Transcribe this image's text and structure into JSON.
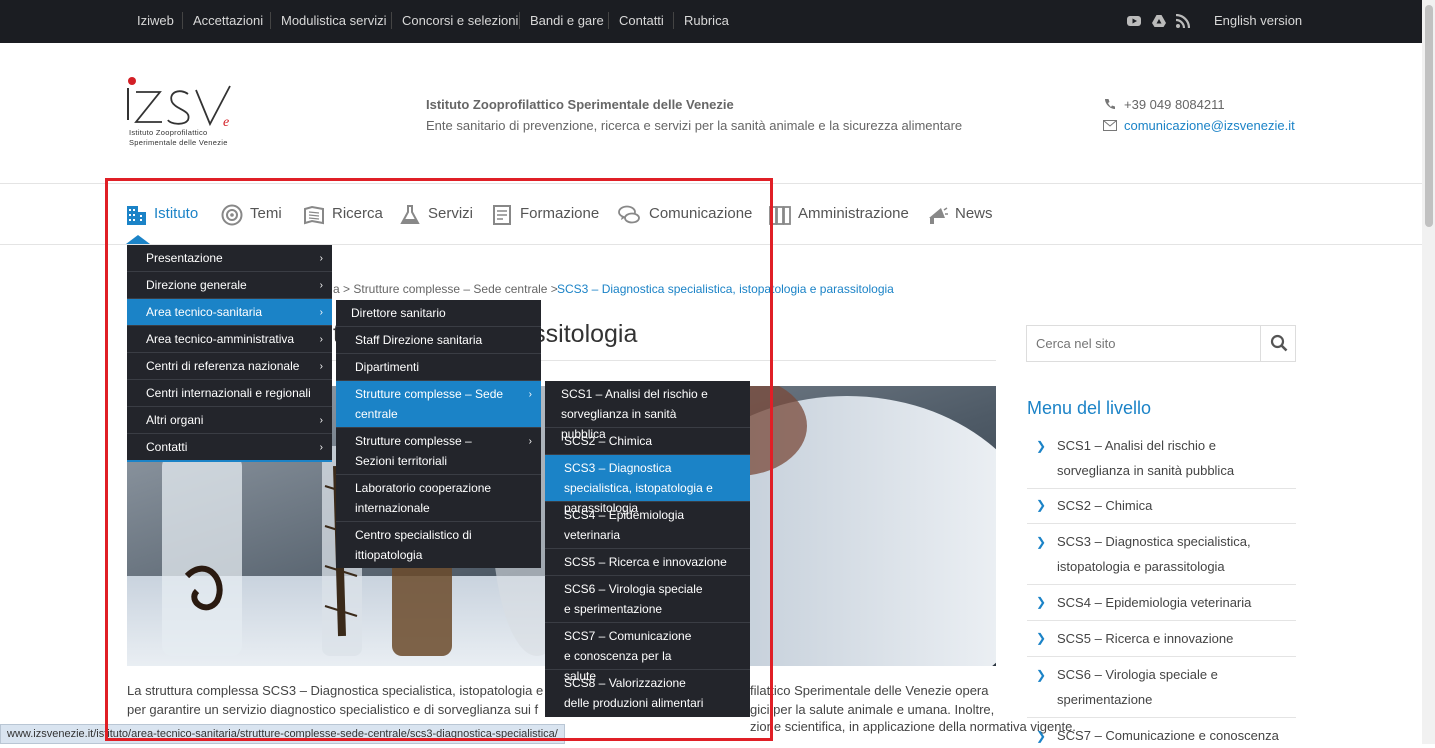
{
  "topbar": {
    "links": [
      "Iziweb",
      "Accettazioni",
      "Modulistica servizi",
      "Concorsi e selezioni",
      "Bandi e gare",
      "Contatti",
      "Rubrica"
    ],
    "social_icons": [
      "youtube-icon",
      "drive-icon",
      "rss-icon"
    ],
    "lang": "English version"
  },
  "header": {
    "logo_mark": "IZSVe",
    "logo_lines": [
      "Istituto Zooprofilattico",
      "Sperimentale delle Venezie"
    ],
    "org_name": "Istituto Zooprofilattico Sperimentale delle Venezie",
    "org_desc": "Ente sanitario di prevenzione, ricerca e servizi per la sanità animale e la sicurezza alimentare",
    "phone": "+39 049 8084211",
    "email": "comunicazione@izsvenezie.it"
  },
  "nav": {
    "items": [
      {
        "label": "Istituto",
        "icon": "building-icon"
      },
      {
        "label": "Temi",
        "icon": "target-icon"
      },
      {
        "label": "Ricerca",
        "icon": "book-icon"
      },
      {
        "label": "Servizi",
        "icon": "flask-icon"
      },
      {
        "label": "Formazione",
        "icon": "document-icon"
      },
      {
        "label": "Comunicazione",
        "icon": "chat-icon"
      },
      {
        "label": "Amministrazione",
        "icon": "folders-icon"
      },
      {
        "label": "News",
        "icon": "megaphone-icon"
      }
    ]
  },
  "menu1": [
    "Presentazione",
    "Direzione generale",
    "Area tecnico-sanitaria",
    "Area tecnico-amministrativa",
    "Centri di referenza nazionale",
    "Centri internazionali e regionali",
    "Altri organi",
    "Contatti"
  ],
  "menu2": [
    "Direttore sanitario",
    "Staff Direzione sanitaria",
    "Dipartimenti",
    "Strutture complesse – Sede centrale",
    "Strutture complesse – Sezioni territoriali",
    "Laboratorio cooperazione internazionale",
    "Centro specialistico di ittiopatologia"
  ],
  "menu3": [
    "SCS1 – Analisi del rischio e sorveglianza in sanità pubblica",
    "SCS2 – Chimica",
    "SCS3 – Diagnostica specialistica, istopatologia e parassitologia",
    "SCS4 – Epidemiologia veterinaria",
    "SCS5 – Ricerca e innovazione",
    "SCS6 – Virologia speciale e sperimentazione",
    "SCS7 – Comunicazione e conoscenza per la salute",
    "SCS8 – Valorizzazione delle produzioni alimentari"
  ],
  "breadcrumb": {
    "visible_part": "a > Strutture complesse – Sede centrale > ",
    "current": "SCS3 – Diagnostica specialistica, istopatologia e parassitologia"
  },
  "page": {
    "title_visible": "topatologia e parassitologia",
    "para_line1_left": "La struttura complessa SCS3 – Diagnostica specialistica, istopatologia e",
    "para_line1_right": "filattico Sperimentale delle Venezie opera",
    "para_line2_left": "per garantire un servizio diagnostico specialistico e di sorveglianza sui f",
    "para_line2_right": "gici per la salute animale e umana. Inoltre,",
    "para_line3_right": "zione scientifica, in applicazione della normativa vigente."
  },
  "sidebar": {
    "search_placeholder": "Cerca nel sito",
    "menu_title": "Menu del livello",
    "items": [
      "SCS1 – Analisi del rischio e sorveglianza in sanità pubblica",
      "SCS2 – Chimica",
      "SCS3 – Diagnostica specialistica, istopatologia e parassitologia",
      "SCS4 – Epidemiologia veterinaria",
      "SCS5 – Ricerca e innovazione",
      "SCS6 – Virologia speciale e sperimentazione",
      "SCS7 – Comunicazione e conoscenza"
    ]
  },
  "statusbar": "www.izsvenezie.it/istituto/area-tecnico-sanitaria/strutture-complesse-sede-centrale/scs3-diagnostica-specialistica/",
  "colors": {
    "accent": "#1b83c7",
    "topbar": "#1b1d22",
    "dropdown": "#23252b",
    "highlight_box": "#e01f26"
  }
}
